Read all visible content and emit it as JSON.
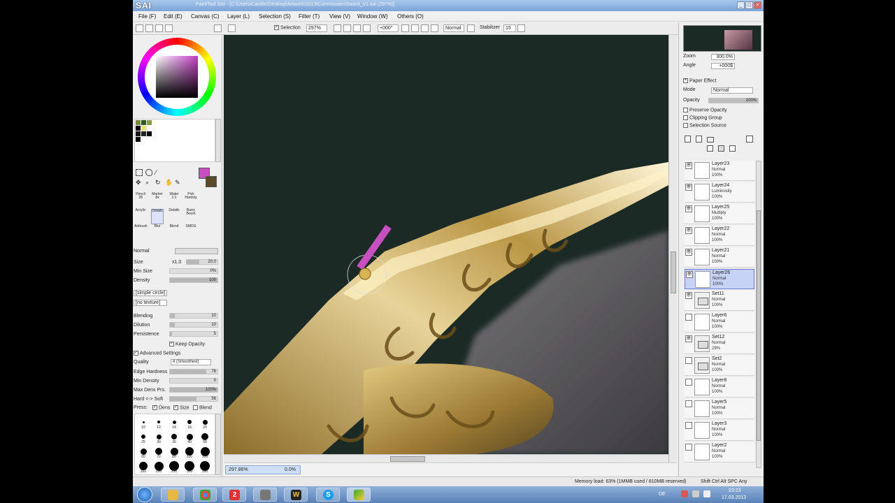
{
  "window": {
    "logo": "SAI",
    "title": "PaintTool SAI - [C:\\Users\\Carolin\\Desktop\\Artwork\\2013\\Commission\\Sword_V1.sai (297%)]"
  },
  "menu": [
    "File (F)",
    "Edit (E)",
    "Canvas (C)",
    "Layer (L)",
    "Selection (S)",
    "Filter (T)",
    "View (V)",
    "Window (W)",
    "Others (O)"
  ],
  "toolbar": {
    "selection_label": "Selection",
    "zoom": "297%",
    "rotation": "+000°",
    "blend_mode": "Normal",
    "stabilizer_label": "Stabilizer",
    "stabilizer_value": "15"
  },
  "brush_tools": {
    "row1": [
      "Pencil",
      "Marker",
      "Water",
      "Pick"
    ],
    "row1_sizes": [
      "28",
      "8x",
      "1:1",
      "Hardsty"
    ],
    "row2": [
      "Acrylic",
      "Details",
      "Details",
      "Basic Brush"
    ],
    "row3": [
      "Airbrush",
      "Blur",
      "Blend",
      "SMDG"
    ]
  },
  "brush_settings": {
    "mode": "Normal",
    "size_label": "Size",
    "size_mult": "x1.0",
    "size_value": "20.0",
    "min_size_label": "Min Size",
    "min_size_value": "0%",
    "density_label": "Density",
    "density_value": "100",
    "shape": "[simple circle]",
    "texture": "[no texture]",
    "blending_label": "Blending",
    "blending_value": "10",
    "dilution_label": "Dilution",
    "dilution_value": "10",
    "persistence_label": "Persistence",
    "persistence_value": "5",
    "keep_opacity": "Keep Opacity",
    "advanced": "Advanced Settings",
    "quality_label": "Quality",
    "quality_value": "4 (Smoothest)",
    "edge_label": "Edge Hardness",
    "edge_value": "76",
    "min_density_label": "Min Density",
    "min_density_value": "0",
    "max_dens_label": "Max Dens Prs.",
    "max_dens_value": "100%",
    "hard_soft_label": "Hard <-> Soft",
    "hard_soft_value": "56",
    "press_label": "Press:",
    "press_dens": "Dens",
    "press_size": "Size",
    "press_blend": "Blend"
  },
  "brush_sizes": [
    "10",
    "12",
    "14",
    "16",
    "20",
    "25",
    "30",
    "35",
    "40",
    "50",
    "60",
    "70",
    "80",
    "100",
    "120",
    "160",
    "200",
    "250",
    "300",
    "350"
  ],
  "navigator": {
    "zoom_label": "Zoom",
    "zoom_value": "300.0%",
    "angle_label": "Angle",
    "angle_value": "+000$",
    "nav_zoom": "297.86%",
    "nav_angle": "0.0%"
  },
  "layer_panel": {
    "paper_effect": "Paper Effect",
    "mode_label": "Mode",
    "mode_value": "Normal",
    "opacity_label": "Opacity",
    "opacity_value": "100%",
    "preserve": "Preserve Opacity",
    "clipping": "Clipping Group",
    "sel_source": "Selection Source"
  },
  "layers": [
    {
      "name": "Layer23",
      "mode": "Normal",
      "opacity": "100%",
      "visible": true,
      "folder": false,
      "selected": false
    },
    {
      "name": "Layer24",
      "mode": "Luminosity",
      "opacity": "100%",
      "visible": true,
      "folder": false,
      "selected": false
    },
    {
      "name": "Layer25",
      "mode": "Multiply",
      "opacity": "100%",
      "visible": true,
      "folder": false,
      "selected": false
    },
    {
      "name": "Layer22",
      "mode": "Normal",
      "opacity": "100%",
      "visible": true,
      "folder": false,
      "selected": false
    },
    {
      "name": "Layer21",
      "mode": "Normal",
      "opacity": "100%",
      "visible": true,
      "folder": false,
      "selected": false
    },
    {
      "name": "Layer26",
      "mode": "Normal",
      "opacity": "100%",
      "visible": true,
      "folder": false,
      "selected": true
    },
    {
      "name": "Set11",
      "mode": "Normal",
      "opacity": "100%",
      "visible": true,
      "folder": true,
      "selected": false
    },
    {
      "name": "Layer6",
      "mode": "Normal",
      "opacity": "100%",
      "visible": false,
      "folder": false,
      "selected": false
    },
    {
      "name": "Set12",
      "mode": "Normal",
      "opacity": "29%",
      "visible": true,
      "folder": true,
      "selected": false
    },
    {
      "name": "Set2",
      "mode": "Normal",
      "opacity": "100%",
      "visible": false,
      "folder": true,
      "selected": false
    },
    {
      "name": "Layer8",
      "mode": "Normal",
      "opacity": "100%",
      "visible": false,
      "folder": false,
      "selected": false
    },
    {
      "name": "Layer5",
      "mode": "Normal",
      "opacity": "100%",
      "visible": false,
      "folder": false,
      "selected": false
    },
    {
      "name": "Layer3",
      "mode": "Normal",
      "opacity": "100%",
      "visible": false,
      "folder": false,
      "selected": false
    },
    {
      "name": "Layer2",
      "mode": "Normal",
      "opacity": "100%",
      "visible": false,
      "folder": false,
      "selected": false
    }
  ],
  "status": {
    "memory": "Memory load: 63% (1MMB used / 810MB reserved)",
    "keys": "Shift Ctrl Alt SPC Any"
  },
  "taskbar": {
    "clock_time": "23:23",
    "clock_date": "17.03.2013",
    "lang": "DE"
  },
  "colors": {
    "canvas_bg": "#1c2a26",
    "gold": "#d9c07a",
    "brush_cursor": "#c84fc0",
    "selected_layer": "#c6d3f7",
    "title_bar": "#7ba3d8"
  }
}
